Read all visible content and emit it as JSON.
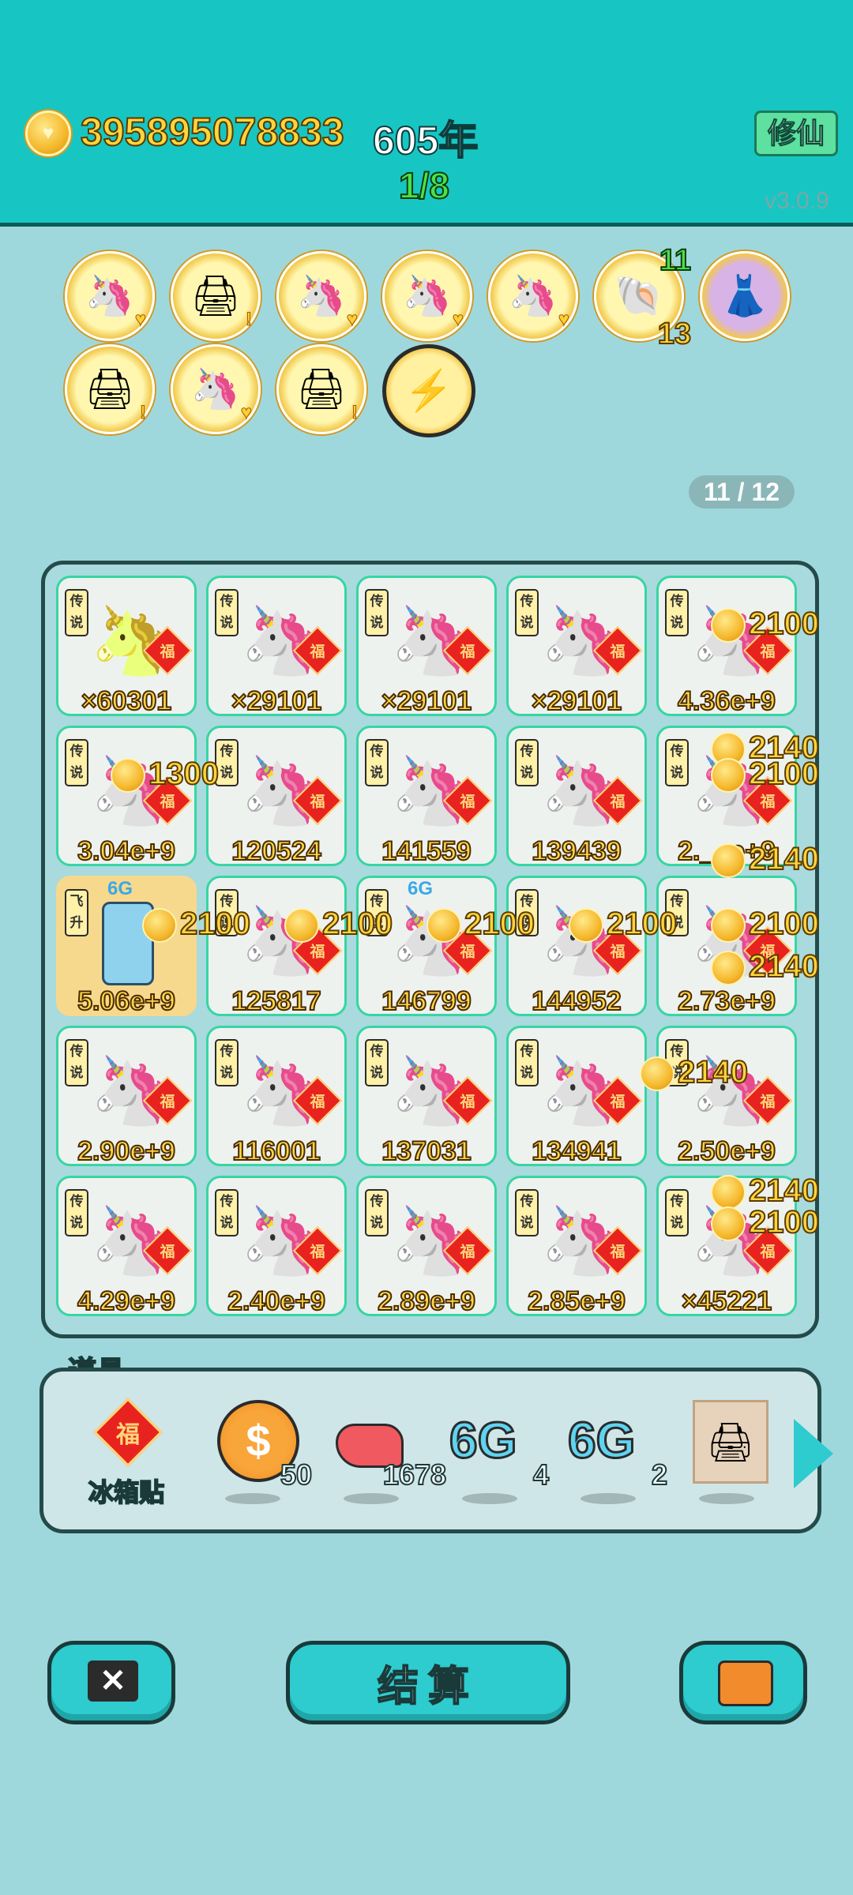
{
  "header": {
    "money": "395895078833",
    "years": "605年",
    "progress": "1/8",
    "xiuxian_label": "修仙",
    "version": "v3.0.9"
  },
  "badges": [
    {
      "icon": "🦄"
    },
    {
      "icon": "🖨"
    },
    {
      "icon": "🦄"
    },
    {
      "icon": "🦄"
    },
    {
      "icon": "🦄"
    },
    {
      "icon": "🐚",
      "top": "11",
      "bottom": "13"
    },
    {
      "icon": "👗"
    },
    {
      "icon": "🖨"
    },
    {
      "icon": "🦄"
    },
    {
      "icon": "🖨"
    },
    {
      "icon": "⚡"
    }
  ],
  "page_indicator": "11 / 12",
  "tag_text": "传说",
  "tag_text_fly": "飞升",
  "cells": [
    [
      "×60301",
      "×29101",
      "×29101",
      "×29101",
      "4.36e+9"
    ],
    [
      "3.04e+9",
      "120524",
      "141559",
      "139439",
      "2.__e+9"
    ],
    [
      "5.06e+9",
      "125817",
      "146799",
      "144952",
      "2.73e+9"
    ],
    [
      "2.90e+9",
      "116001",
      "137031",
      "134941",
      "2.50e+9"
    ],
    [
      "4.29e+9",
      "2.40e+9",
      "2.89e+9",
      "2.85e+9",
      "×45221"
    ]
  ],
  "floats": {
    "a": "2100",
    "b": "1300",
    "c": "2140",
    "d": "2100",
    "e": "2140"
  },
  "sixg": "6G",
  "props": {
    "label": "道具",
    "items": [
      {
        "name": "冰箱贴",
        "qty": ""
      },
      {
        "name": "coin",
        "qty": "50"
      },
      {
        "name": "liver",
        "qty": "1678"
      },
      {
        "name": "6G",
        "qty": "4"
      },
      {
        "name": "6G",
        "qty": "2"
      },
      {
        "name": "printer-frame",
        "qty": ""
      }
    ],
    "fu_char": "福"
  },
  "buttons": {
    "settle": "结算"
  }
}
